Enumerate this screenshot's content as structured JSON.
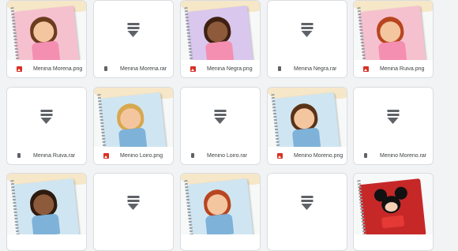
{
  "files": [
    {
      "name": "Menina Morena.png",
      "type": "png",
      "art": {
        "bg": "#f6c1cf",
        "hair": "#6d3b1e",
        "skin": "#f4c6a0",
        "shirt": "#f48fb1"
      }
    },
    {
      "name": "Menina Morena.rar",
      "type": "rar"
    },
    {
      "name": "Menina Negra.png",
      "type": "png",
      "art": {
        "bg": "#d9c7ee",
        "hair": "#3e2112",
        "skin": "#8d5a3b",
        "shirt": "#f48fb1"
      }
    },
    {
      "name": "Menina Negra.rar",
      "type": "rar"
    },
    {
      "name": "Menina Ruiva.png",
      "type": "png",
      "art": {
        "bg": "#f6c1cf",
        "hair": "#b8451f",
        "skin": "#f4c6a0",
        "shirt": "#f48fb1"
      }
    },
    {
      "name": "Menina Ruiva.rar",
      "type": "rar"
    },
    {
      "name": "Menino Loiro.png",
      "type": "png",
      "art": {
        "bg": "#cfe6f2",
        "hair": "#d8a84f",
        "skin": "#f4c6a0",
        "shirt": "#7fb2d8"
      }
    },
    {
      "name": "Menino Loiro.rar",
      "type": "rar"
    },
    {
      "name": "Menino Moreno.png",
      "type": "png",
      "art": {
        "bg": "#cfe6f2",
        "hair": "#5a3218",
        "skin": "#f4c6a0",
        "shirt": "#7fb2d8"
      }
    },
    {
      "name": "Menino Moreno.rar",
      "type": "rar"
    },
    {
      "name": "",
      "type": "png",
      "art": {
        "bg": "#cfe6f2",
        "hair": "#2e1a10",
        "skin": "#8d5a3b",
        "shirt": "#7fb2d8"
      }
    },
    {
      "name": "",
      "type": "rar"
    },
    {
      "name": "",
      "type": "png",
      "art": {
        "bg": "#cfe6f2",
        "hair": "#b8451f",
        "skin": "#f4c6a0",
        "shirt": "#7fb2d8"
      }
    },
    {
      "name": "",
      "type": "rar"
    },
    {
      "name": "",
      "type": "mickey"
    }
  ],
  "icons": {
    "png": "image-file-icon",
    "rar": "archive-file-icon",
    "download": "archive-stack-icon"
  },
  "colors": {
    "png_icon": "#d93025",
    "archive_icon": "#5f6368",
    "background": "#f1f3f4"
  }
}
